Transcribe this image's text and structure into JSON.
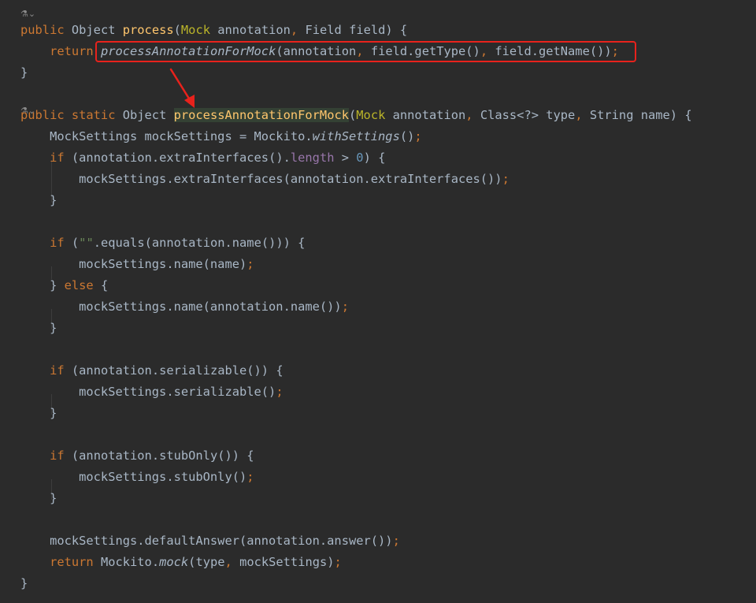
{
  "editor": {
    "gutter_hint_1": "⚗⌄",
    "gutter_hint_2": "⚗⌄",
    "lines": [
      [
        {
          "t": "public ",
          "c": "kw"
        },
        {
          "t": "Object ",
          "c": "def"
        },
        {
          "t": "process",
          "c": "fn"
        },
        {
          "t": "(",
          "c": "def"
        },
        {
          "t": "Mock ",
          "c": "ann"
        },
        {
          "t": "annotation",
          "c": "def"
        },
        {
          "t": ", ",
          "c": "kw"
        },
        {
          "t": "Field field) {",
          "c": "def"
        }
      ],
      [
        {
          "t": "    "
        },
        {
          "t": "return ",
          "c": "kw"
        },
        {
          "t": "processAnnotationForMock",
          "c": "call"
        },
        {
          "t": "(annotation",
          "c": "def"
        },
        {
          "t": ", ",
          "c": "kw"
        },
        {
          "t": "field.getType()",
          "c": "def"
        },
        {
          "t": ", ",
          "c": "kw"
        },
        {
          "t": "field.getName())",
          "c": "def"
        },
        {
          "t": ";",
          "c": "kw"
        }
      ],
      [
        {
          "t": "}",
          "c": "def"
        }
      ],
      [
        {
          "t": ""
        }
      ],
      [
        {
          "t": "public static ",
          "c": "kw"
        },
        {
          "t": "Object ",
          "c": "def"
        },
        {
          "t": "processAnnotationForMock",
          "c": "fn hl"
        },
        {
          "t": "(",
          "c": "def"
        },
        {
          "t": "Mock ",
          "c": "ann"
        },
        {
          "t": "annotation",
          "c": "def"
        },
        {
          "t": ", ",
          "c": "kw"
        },
        {
          "t": "Class<?> type",
          "c": "def"
        },
        {
          "t": ", ",
          "c": "kw"
        },
        {
          "t": "String name) {",
          "c": "def"
        }
      ],
      [
        {
          "t": "    MockSettings mockSettings = Mockito.",
          "c": "def"
        },
        {
          "t": "withSettings",
          "c": "it"
        },
        {
          "t": "()",
          "c": "def"
        },
        {
          "t": ";",
          "c": "kw"
        }
      ],
      [
        {
          "t": "    "
        },
        {
          "t": "if ",
          "c": "kw"
        },
        {
          "t": "(annotation.extraInterfaces().",
          "c": "def"
        },
        {
          "t": "length ",
          "c": "fld"
        },
        {
          "t": "> ",
          "c": "def"
        },
        {
          "t": "0",
          "c": "num"
        },
        {
          "t": ") {",
          "c": "def"
        }
      ],
      [
        {
          "t": "        mockSettings.extraInterfaces(annotation.extraInterfaces())",
          "c": "def"
        },
        {
          "t": ";",
          "c": "kw"
        }
      ],
      [
        {
          "t": "    }",
          "c": "def"
        }
      ],
      [
        {
          "t": ""
        }
      ],
      [
        {
          "t": "    "
        },
        {
          "t": "if ",
          "c": "kw"
        },
        {
          "t": "(",
          "c": "def"
        },
        {
          "t": "\"\"",
          "c": "str"
        },
        {
          "t": ".equals(annotation.name())) {",
          "c": "def"
        }
      ],
      [
        {
          "t": "        mockSettings.name(name)",
          "c": "def"
        },
        {
          "t": ";",
          "c": "kw"
        }
      ],
      [
        {
          "t": "    } ",
          "c": "def"
        },
        {
          "t": "else ",
          "c": "kw"
        },
        {
          "t": "{",
          "c": "def"
        }
      ],
      [
        {
          "t": "        mockSettings.name(annotation.name())",
          "c": "def"
        },
        {
          "t": ";",
          "c": "kw"
        }
      ],
      [
        {
          "t": "    }",
          "c": "def"
        }
      ],
      [
        {
          "t": ""
        }
      ],
      [
        {
          "t": "    "
        },
        {
          "t": "if ",
          "c": "kw"
        },
        {
          "t": "(annotation.serializable()) {",
          "c": "def"
        }
      ],
      [
        {
          "t": "        mockSettings.serializable()",
          "c": "def"
        },
        {
          "t": ";",
          "c": "kw"
        }
      ],
      [
        {
          "t": "    }",
          "c": "def"
        }
      ],
      [
        {
          "t": ""
        }
      ],
      [
        {
          "t": "    "
        },
        {
          "t": "if ",
          "c": "kw"
        },
        {
          "t": "(annotation.stubOnly()) {",
          "c": "def"
        }
      ],
      [
        {
          "t": "        mockSettings.stubOnly()",
          "c": "def"
        },
        {
          "t": ";",
          "c": "kw"
        }
      ],
      [
        {
          "t": "    }",
          "c": "def"
        }
      ],
      [
        {
          "t": ""
        }
      ],
      [
        {
          "t": "    mockSettings.defaultAnswer(annotation.answer())",
          "c": "def"
        },
        {
          "t": ";",
          "c": "kw"
        }
      ],
      [
        {
          "t": "    "
        },
        {
          "t": "return ",
          "c": "kw"
        },
        {
          "t": "Mockito.",
          "c": "def"
        },
        {
          "t": "mock",
          "c": "it"
        },
        {
          "t": "(type",
          "c": "def"
        },
        {
          "t": ", ",
          "c": "kw"
        },
        {
          "t": "mockSettings)",
          "c": "def"
        },
        {
          "t": ";",
          "c": "kw"
        }
      ],
      [
        {
          "t": "}",
          "c": "def"
        }
      ]
    ]
  },
  "annotation": {
    "box_color": "#e8221c"
  }
}
